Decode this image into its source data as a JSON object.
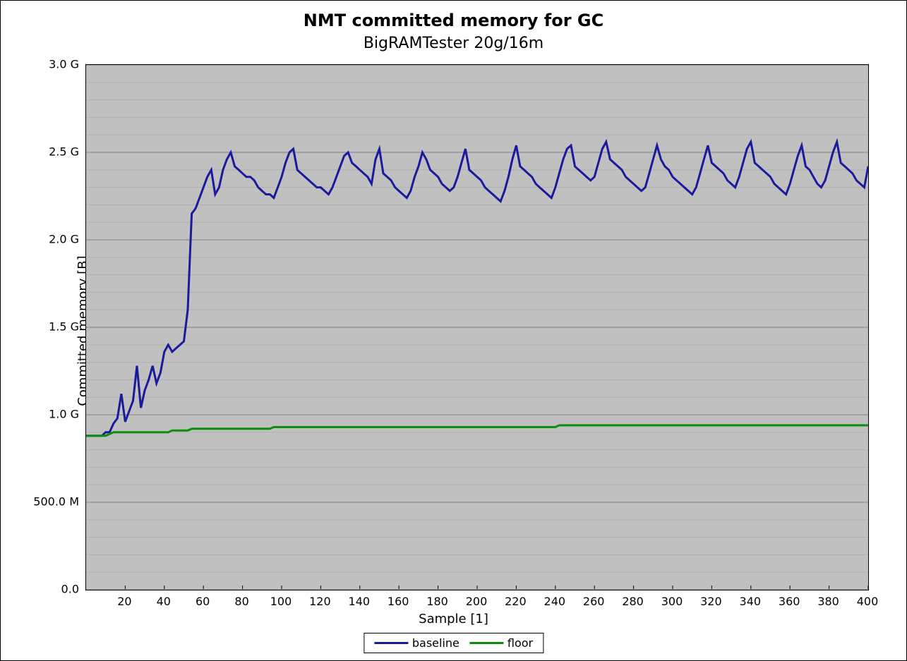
{
  "chart_data": {
    "type": "line",
    "title": "NMT committed memory for GC",
    "subtitle": "BigRAMTester 20g/16m",
    "xlabel": "Sample [1]",
    "ylabel": "Committed memory [B]",
    "xlim": [
      0,
      400
    ],
    "ylim": [
      0,
      3000000000
    ],
    "x_ticks": [
      20,
      40,
      60,
      80,
      100,
      120,
      140,
      160,
      180,
      200,
      220,
      240,
      260,
      280,
      300,
      320,
      340,
      360,
      380,
      400
    ],
    "y_ticks_major": [
      0,
      500000000,
      1000000000,
      1500000000,
      2000000000,
      2500000000,
      3000000000
    ],
    "y_tick_labels": [
      "0.0",
      "500.0 M",
      "1.0 G",
      "1.5 G",
      "2.0 G",
      "2.5 G",
      "3.0 G"
    ],
    "y_minor_step": 100000000,
    "legend_position": "bottom",
    "colors": {
      "baseline": "#1a1a9c",
      "floor": "#0b8f0b"
    },
    "series": [
      {
        "name": "baseline",
        "x_step": 2,
        "x_start": 0,
        "values": [
          0.88,
          0.88,
          0.88,
          0.88,
          0.88,
          0.9,
          0.9,
          0.95,
          0.98,
          1.12,
          0.96,
          1.02,
          1.08,
          1.28,
          1.04,
          1.14,
          1.2,
          1.28,
          1.18,
          1.24,
          1.36,
          1.4,
          1.36,
          1.38,
          1.4,
          1.42,
          1.6,
          2.15,
          2.18,
          2.24,
          2.3,
          2.36,
          2.4,
          2.26,
          2.3,
          2.4,
          2.46,
          2.5,
          2.42,
          2.4,
          2.38,
          2.36,
          2.36,
          2.34,
          2.3,
          2.28,
          2.26,
          2.26,
          2.24,
          2.3,
          2.36,
          2.44,
          2.5,
          2.52,
          2.4,
          2.38,
          2.36,
          2.34,
          2.32,
          2.3,
          2.3,
          2.28,
          2.26,
          2.3,
          2.36,
          2.42,
          2.48,
          2.5,
          2.44,
          2.42,
          2.4,
          2.38,
          2.36,
          2.32,
          2.46,
          2.52,
          2.38,
          2.36,
          2.34,
          2.3,
          2.28,
          2.26,
          2.24,
          2.28,
          2.36,
          2.42,
          2.5,
          2.46,
          2.4,
          2.38,
          2.36,
          2.32,
          2.3,
          2.28,
          2.3,
          2.36,
          2.44,
          2.52,
          2.4,
          2.38,
          2.36,
          2.34,
          2.3,
          2.28,
          2.26,
          2.24,
          2.22,
          2.28,
          2.36,
          2.46,
          2.54,
          2.42,
          2.4,
          2.38,
          2.36,
          2.32,
          2.3,
          2.28,
          2.26,
          2.24,
          2.3,
          2.38,
          2.46,
          2.52,
          2.54,
          2.42,
          2.4,
          2.38,
          2.36,
          2.34,
          2.36,
          2.44,
          2.52,
          2.56,
          2.46,
          2.44,
          2.42,
          2.4,
          2.36,
          2.34,
          2.32,
          2.3,
          2.28,
          2.3,
          2.38,
          2.46,
          2.54,
          2.46,
          2.42,
          2.4,
          2.36,
          2.34,
          2.32,
          2.3,
          2.28,
          2.26,
          2.3,
          2.38,
          2.46,
          2.54,
          2.44,
          2.42,
          2.4,
          2.38,
          2.34,
          2.32,
          2.3,
          2.36,
          2.44,
          2.52,
          2.56,
          2.44,
          2.42,
          2.4,
          2.38,
          2.36,
          2.32,
          2.3,
          2.28,
          2.26,
          2.32,
          2.4,
          2.48,
          2.54,
          2.42,
          2.4,
          2.36,
          2.32,
          2.3,
          2.34,
          2.42,
          2.5,
          2.56,
          2.44,
          2.42,
          2.4,
          2.38,
          2.34,
          2.32,
          2.3,
          2.42
        ],
        "value_scale": 1000000000
      },
      {
        "name": "floor",
        "x_step": 2,
        "x_start": 0,
        "values": [
          0.88,
          0.88,
          0.88,
          0.88,
          0.88,
          0.88,
          0.89,
          0.9,
          0.9,
          0.9,
          0.9,
          0.9,
          0.9,
          0.9,
          0.9,
          0.9,
          0.9,
          0.9,
          0.9,
          0.9,
          0.9,
          0.9,
          0.91,
          0.91,
          0.91,
          0.91,
          0.91,
          0.92,
          0.92,
          0.92,
          0.92,
          0.92,
          0.92,
          0.92,
          0.92,
          0.92,
          0.92,
          0.92,
          0.92,
          0.92,
          0.92,
          0.92,
          0.92,
          0.92,
          0.92,
          0.92,
          0.92,
          0.92,
          0.93,
          0.93,
          0.93,
          0.93,
          0.93,
          0.93,
          0.93,
          0.93,
          0.93,
          0.93,
          0.93,
          0.93,
          0.93,
          0.93,
          0.93,
          0.93,
          0.93,
          0.93,
          0.93,
          0.93,
          0.93,
          0.93,
          0.93,
          0.93,
          0.93,
          0.93,
          0.93,
          0.93,
          0.93,
          0.93,
          0.93,
          0.93,
          0.93,
          0.93,
          0.93,
          0.93,
          0.93,
          0.93,
          0.93,
          0.93,
          0.93,
          0.93,
          0.93,
          0.93,
          0.93,
          0.93,
          0.93,
          0.93,
          0.93,
          0.93,
          0.93,
          0.93,
          0.93,
          0.93,
          0.93,
          0.93,
          0.93,
          0.93,
          0.93,
          0.93,
          0.93,
          0.93,
          0.93,
          0.93,
          0.93,
          0.93,
          0.93,
          0.93,
          0.93,
          0.93,
          0.93,
          0.93,
          0.93,
          0.94,
          0.94,
          0.94,
          0.94,
          0.94,
          0.94,
          0.94,
          0.94,
          0.94,
          0.94,
          0.94,
          0.94,
          0.94,
          0.94,
          0.94,
          0.94,
          0.94,
          0.94,
          0.94,
          0.94,
          0.94,
          0.94,
          0.94,
          0.94,
          0.94,
          0.94,
          0.94,
          0.94,
          0.94,
          0.94,
          0.94,
          0.94,
          0.94,
          0.94,
          0.94,
          0.94,
          0.94,
          0.94,
          0.94,
          0.94,
          0.94,
          0.94,
          0.94,
          0.94,
          0.94,
          0.94,
          0.94,
          0.94,
          0.94,
          0.94,
          0.94,
          0.94,
          0.94,
          0.94,
          0.94,
          0.94,
          0.94,
          0.94,
          0.94,
          0.94,
          0.94,
          0.94,
          0.94,
          0.94,
          0.94,
          0.94,
          0.94,
          0.94,
          0.94,
          0.94,
          0.94,
          0.94,
          0.94,
          0.94,
          0.94,
          0.94,
          0.94,
          0.94,
          0.94,
          0.94
        ],
        "value_scale": 1000000000
      }
    ]
  }
}
